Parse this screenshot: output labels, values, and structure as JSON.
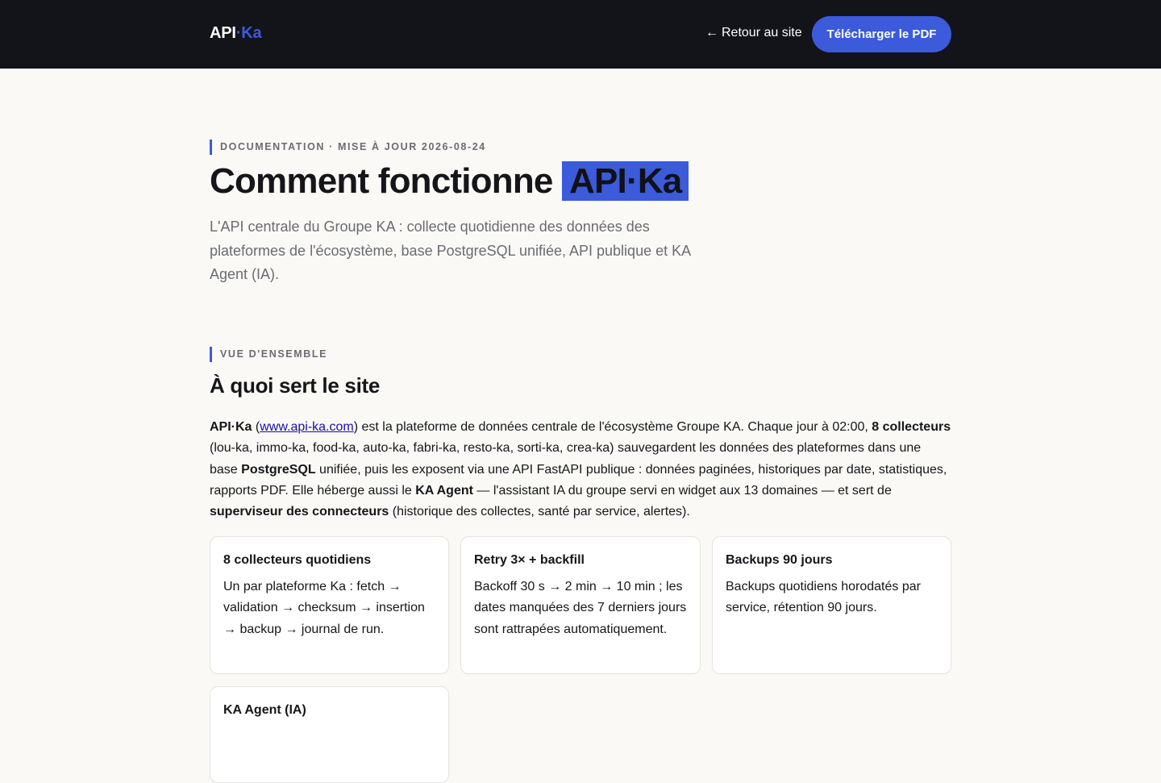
{
  "header": {
    "logo_main": "API",
    "logo_accent": "·Ka",
    "back_arrow": "←",
    "back_label": "Retour au site",
    "pdf_button": "Télécharger le PDF"
  },
  "hero": {
    "eyebrow": "DOCUMENTATION · MISE À JOUR 2026-08-24",
    "title_prefix": "Comment fonctionne",
    "title_highlight": "API·Ka",
    "subtitle": "L'API centrale du Groupe KA : collecte quotidienne des données des plateformes de l'écosystème, base PostgreSQL unifiée, API publique et KA Agent (IA)."
  },
  "overview": {
    "eyebrow": "VUE D'ENSEMBLE",
    "title": "À quoi sert le site",
    "intro": {
      "brand": "API·Ka",
      "open_paren": " (",
      "link": "www.api-ka.com",
      "t1": ") est la plateforme de données centrale de l'écosystème Groupe KA. Chaque jour à 02:00, ",
      "b1": "8 collecteurs",
      "t2": " (lou-ka, immo-ka, food-ka, auto-ka, fabri-ka, resto-ka, sorti-ka, crea-ka) sauvegardent les données des plateformes dans une base ",
      "b2": "PostgreSQL",
      "t3": " unifiée, puis les exposent via une API FastAPI publique : données paginées, historiques par date, statistiques, rapports PDF. Elle héberge aussi le ",
      "b3": "KA Agent",
      "t4": " — l'assistant IA du groupe servi en widget aux 13 domaines — et sert de ",
      "b4": "superviseur des connecteurs",
      "t5": " (historique des collectes, santé par service, alertes)."
    },
    "cards": [
      {
        "title": "8 collecteurs quotidiens",
        "text": "Un par plateforme Ka : fetch → validation → checksum → insertion → backup → journal de run."
      },
      {
        "title": "Retry 3× + backfill",
        "text": "Backoff 30 s → 2 min → 10 min ; les dates manquées des 7 derniers jours sont rattrapées automatiquement."
      },
      {
        "title": "Backups 90 jours",
        "text": "Backups quotidiens horodatés par service, rétention 90 jours."
      },
      {
        "title": "KA Agent (IA)",
        "text": ""
      }
    ]
  },
  "colors": {
    "accent": "#3b5bdb",
    "topbar": "#13131a",
    "background": "#faf9f6"
  }
}
